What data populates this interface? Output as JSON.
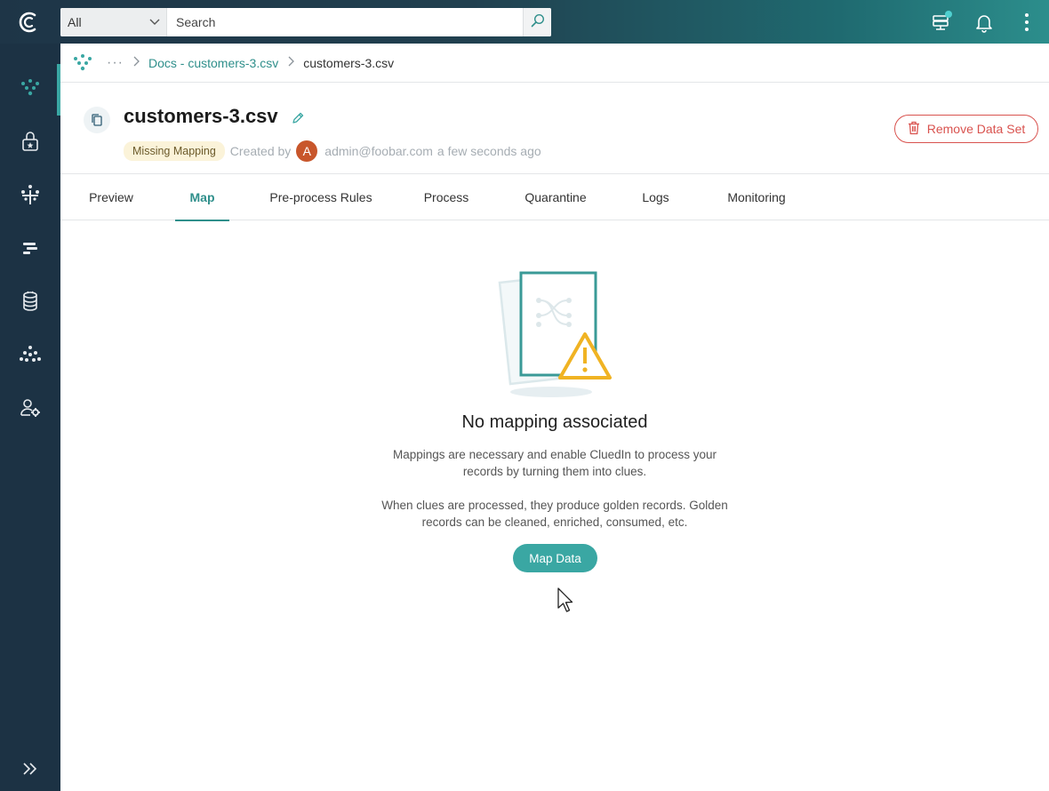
{
  "search": {
    "scope": "All",
    "placeholder": "Search"
  },
  "breadcrumb": {
    "ellipsis": "···",
    "parent": "Docs - customers-3.csv",
    "current": "customers-3.csv"
  },
  "header": {
    "title": "customers-3.csv",
    "badge": "Missing Mapping",
    "created_by_label": "Created by",
    "avatar_initial": "A",
    "author": "admin@foobar.com",
    "time": "a few seconds ago",
    "remove_button": "Remove Data Set"
  },
  "tabs": [
    "Preview",
    "Map",
    "Pre-process Rules",
    "Process",
    "Quarantine",
    "Logs",
    "Monitoring"
  ],
  "active_tab": "Map",
  "empty_state": {
    "title": "No mapping associated",
    "line1": "Mappings are necessary and enable CluedIn to process your",
    "line2": "records by turning them into clues.",
    "line3": "When clues are processed, they produce golden records. Golden",
    "line4": "records can be cleaned, enriched, consumed, etc.",
    "button": "Map Data"
  },
  "colors": {
    "accent": "#3aa7a3",
    "danger": "#d9534f",
    "sidebar": "#1c3244",
    "warning": "#f0b323"
  },
  "icons": {
    "sidebar": [
      "integrations-icon",
      "governance-lock-icon",
      "preparation-icon",
      "management-icon",
      "database-icon",
      "consume-icon",
      "admin-user-settings-icon"
    ],
    "topbar": [
      "logo-icon",
      "server-status-icon",
      "notifications-bell-icon",
      "more-vert-icon"
    ]
  }
}
